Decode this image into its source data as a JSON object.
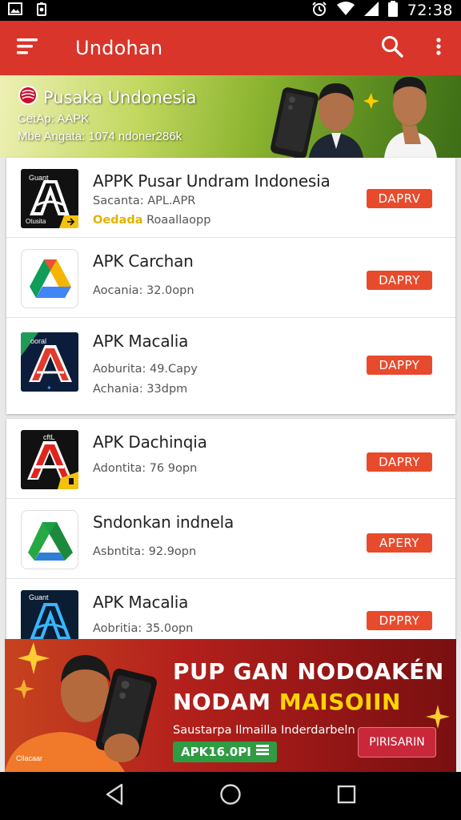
{
  "status_bar": {
    "time": "72:38",
    "icons": [
      "image-icon",
      "battery-alert-icon",
      "alarm-icon",
      "wifi-icon",
      "cellular-icon",
      "battery-icon"
    ]
  },
  "app_bar": {
    "title": "Undohan",
    "icons": [
      "menu-icon",
      "search-icon",
      "more-vert-icon"
    ]
  },
  "promo": {
    "title": "Pusaka Undonesia",
    "line1": "CetAp: AAPK",
    "line2": "Mbe Angata: 1074 ndoner286k"
  },
  "apps": [
    {
      "name": "APPK Pusar Undram Indonesia",
      "meta1": "Sacanta:  APL.APR",
      "meta2_highlight": "Oedada",
      "meta2": "Roaallaopp",
      "button": "DAPRV",
      "icon": "stylized-a-icon-black"
    },
    {
      "name": "APK Carchan",
      "meta1": "Aocania: 32.0opn",
      "button": "DAPRY",
      "icon": "drive-triangle-icon"
    },
    {
      "name": "APK Macalia",
      "meta1": "Aoburita: 49.Capy",
      "meta2": "Achania: 33dpm",
      "button": "DAPPY",
      "icon": "stylized-a-icon-red"
    },
    {
      "name": "APK Dachinqia",
      "meta1": "Adontita: 76 9opn",
      "button": "DAPRY",
      "icon": "stylized-a-icon-red-black"
    },
    {
      "name": "Sndonkan indnela",
      "meta1": "Asbntita: 92.9opn",
      "button": "APERY",
      "icon": "green-triangle-icon"
    },
    {
      "name": "APK Macalia",
      "meta1": "Aobritia: 35.0opn",
      "button": "DPPRY",
      "icon": "stylized-a-icon-blue"
    }
  ],
  "ad": {
    "headline_line1": "PUP GAN NODOAKÉN",
    "headline_line2_a": "NODAM ",
    "headline_line2_b": "MAISOIIN",
    "sub": "Saustarpa Ilmailla Inderdarbeln",
    "code": "APK16.0PI",
    "cta": "PIRISARIN"
  },
  "nav_bar": {
    "icons": [
      "back-icon",
      "home-icon",
      "recents-icon"
    ]
  },
  "colors": {
    "primary": "#d9352a",
    "button": "#e84a2c",
    "ad_code": "#2f9b42",
    "ad_highlight": "#ffd400"
  }
}
